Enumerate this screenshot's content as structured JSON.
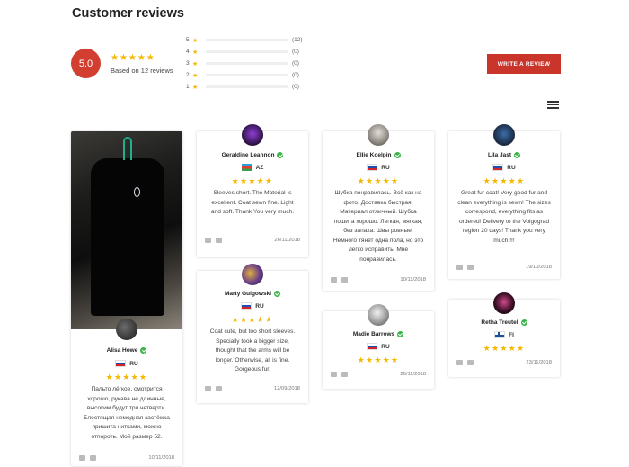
{
  "page_title": "Customer reviews",
  "summary": {
    "score": "5.0",
    "stars": "★★★★★",
    "based_on": "Based on 12 reviews",
    "histogram": [
      {
        "rating": "5",
        "count": "(12)",
        "fraction": 1.0
      },
      {
        "rating": "4",
        "count": "(0)",
        "fraction": 0
      },
      {
        "rating": "3",
        "count": "(0)",
        "fraction": 0
      },
      {
        "rating": "2",
        "count": "(0)",
        "fraction": 0
      },
      {
        "rating": "1",
        "count": "(0)",
        "fraction": 0
      }
    ],
    "star_glyph": "★"
  },
  "write_review_label": "WRITE A REVIEW",
  "colors": {
    "accent": "#d23f31",
    "star": "#f5b800",
    "verified": "#3bb54a"
  },
  "reviews": [
    {
      "name": "Alisa Howe",
      "country": "RU",
      "stars": "★★★★★",
      "text": "Пальто лёгкое, смотрится хорошо, рукава не длинные, высоким будут три четверти. Блестящая немодная застёжка пришита нитками, можно отпороть. Мой размер 52.",
      "date": "10/11/2018",
      "has_photo": true
    },
    {
      "name": "Geraldine Leannon",
      "country": "AZ",
      "stars": "★★★★★",
      "text": "Sleeves short. The Material Is excellent. Coat sewn fine. Light and soft. Thank You very much.",
      "date": "26/11/2018"
    },
    {
      "name": "Marty Gulgowski",
      "country": "RU",
      "stars": "★★★★★",
      "text": "Coat cute, but too short sleeves. Specially took a bigger size, thought that the arms will be longer. Otherwise, all is fine. Gorgeous fur.",
      "date": "12/09/2018"
    },
    {
      "name": "Ellie Koelpin",
      "country": "RU",
      "stars": "★★★★★",
      "text": "Шубка понравилась. Всё как на фото. Доставка быстрая. Материал отличный. Шубка пошита хорошо. Легкая, мягкая, без запаха. Швы ровные. Немного тянет одна пола, но это легко исправить. Мне понравилась.",
      "date": "10/11/2018"
    },
    {
      "name": "Madie Barrows",
      "country": "RU",
      "stars": "★★★★★",
      "text": "",
      "date": "26/11/2018"
    },
    {
      "name": "Lila Jast",
      "country": "RU",
      "stars": "★★★★★",
      "text": "Great fur coat! Very good fur and clean everything is sewn! The sizes correspond, everything fits as ordered! Delivery to the Volgograd region 20 days! Thank you very much !!!",
      "date": "19/10/2018"
    },
    {
      "name": "Retha Treutel",
      "country": "FI",
      "stars": "★★★★★",
      "text": "",
      "date": "23/11/2018"
    }
  ]
}
